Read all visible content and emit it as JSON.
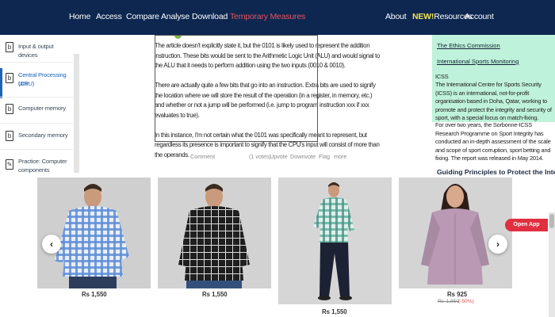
{
  "nav": {
    "left": [
      "Home",
      "Access",
      "Compare",
      "Analyse",
      "Download",
      "Temporary Measures"
    ],
    "right_about": "About",
    "new_badge": "NEW!",
    "resources": "Resources",
    "account": "Account",
    "bg_color": "#0d2750",
    "highlight_color": "#e8525d"
  },
  "sidebar": {
    "items": [
      {
        "label_lines": [
          "Input & output devices"
        ],
        "icon": "document-icon"
      },
      {
        "label_lines": [
          "Central Processing Unit",
          "(CPU)"
        ],
        "icon": "document-icon",
        "active": true
      },
      {
        "label_lines": [
          "Computer memory"
        ],
        "icon": "document-icon"
      },
      {
        "label_lines": [
          "Secondary memory"
        ],
        "icon": "document-icon"
      },
      {
        "label_lines": [
          "Practice: Computer",
          "components"
        ],
        "icon": "pencil-icon"
      }
    ]
  },
  "article": {
    "lines": [
      "The article doesn't explicitly state it, but the 0101 is likely used to represent the addition",
      "instruction. These bits would be sent to the Arithmetic Logic Unit (ALU) and would signal to",
      "the ALU that it needs to perform addition using the two inputs (0010 & 0010).",
      "",
      "There are actually quite a few bits that go into an instruction. Extra bits are used to signify",
      "the location where we will store the result of the operation (in a register, in memory, etc.)",
      "and whether or not a jump will be performed (i.e. jump to program instruction xxx if xxx",
      "evaluates to true).",
      "",
      "In this instance, I'm not certain what the 0101 was specifically meant to represent, but",
      "regardless its presence is important to signify that the CPU's input will consist of more than",
      "the operands."
    ],
    "actions": {
      "comment": "Comment",
      "votes": "(1 votes)",
      "upvote": "Upvote",
      "downvote": "Downvote",
      "flag": "Flag",
      "more": "more"
    }
  },
  "right_panel": {
    "links": [
      "The Ethics Commission",
      "International Sports Monitoring"
    ],
    "icss_title": "ICSS",
    "para1": "The International Centre for Sports Security (ICSS) is an international, not-for-profit organisation based in Doha, Qatar, working to promote and protect the integrity and security of sport, with a special focus on match-fixing.",
    "para2": "For over two years, the Sorbonne-ICSS Research Programme on Sport Integrity has conducted an in-depth assessment of the scale and scope of sport corruption, sport betting and fixing. The report was released in May 2014.",
    "heading": "Guiding Principles to Protect the Integrity",
    "green_color": "#bff2da"
  },
  "products": [
    {
      "price": "Rs 1,550",
      "shirt_color": "#5f8fd6"
    },
    {
      "price": "Rs 1,550",
      "shirt_color": "#2a2a2a"
    },
    {
      "price": "Rs 1,550",
      "shirt_color": "#6cb7a6"
    },
    {
      "price": "Rs 925",
      "original_price": "Rs 1,850",
      "discount": "(-50%)",
      "shirt_color": "#b999b3"
    }
  ],
  "carousel": {
    "prev_icon": "chevron-left-icon",
    "next_icon": "chevron-right-icon",
    "open_app": "Open App"
  }
}
